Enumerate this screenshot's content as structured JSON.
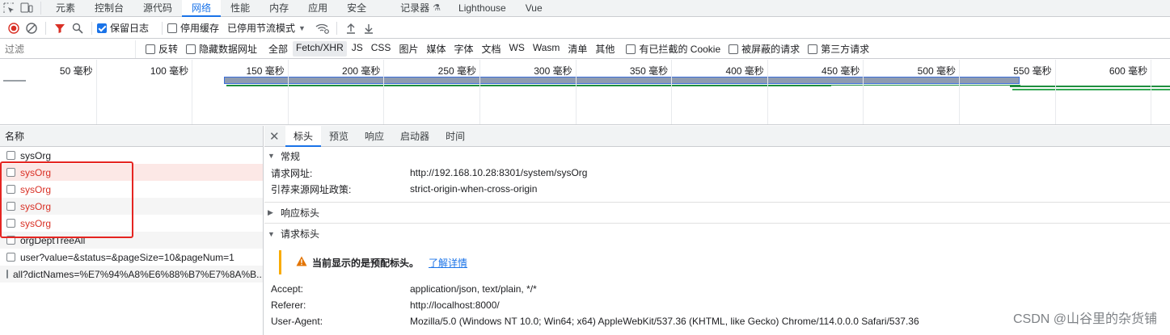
{
  "tabbar": {
    "tabs": [
      "元素",
      "控制台",
      "源代码",
      "网络",
      "性能",
      "内存",
      "应用",
      "安全",
      "记录器",
      "Lighthouse",
      "Vue"
    ],
    "active": "网络"
  },
  "toolbar": {
    "preserve_log": "保留日志",
    "disable_cache": "停用缓存",
    "throttle": "已停用节流模式"
  },
  "filter": {
    "placeholder": "过滤",
    "invert": "反转",
    "hide_data_urls": "隐藏数据网址",
    "types": [
      "全部",
      "Fetch/XHR",
      "JS",
      "CSS",
      "图片",
      "媒体",
      "字体",
      "文档",
      "WS",
      "Wasm",
      "清单",
      "其他"
    ],
    "selected_type": "Fetch/XHR",
    "blocked_cookies": "有已拦截的 Cookie",
    "blocked_requests": "被屏蔽的请求",
    "third_party": "第三方请求"
  },
  "timeline": {
    "ticks": [
      "50 毫秒",
      "100 毫秒",
      "150 毫秒",
      "200 毫秒",
      "250 毫秒",
      "300 毫秒",
      "350 毫秒",
      "400 毫秒",
      "450 毫秒",
      "500 毫秒",
      "550 毫秒",
      "600 毫秒"
    ]
  },
  "requests": {
    "header": "名称",
    "rows": [
      {
        "name": "sysOrg",
        "error": false
      },
      {
        "name": "sysOrg",
        "error": true
      },
      {
        "name": "sysOrg",
        "error": true
      },
      {
        "name": "sysOrg",
        "error": true
      },
      {
        "name": "sysOrg",
        "error": true
      },
      {
        "name": "orgDeptTreeAll",
        "error": false
      },
      {
        "name": "user?value=&status=&pageSize=10&pageNum=1",
        "error": false
      },
      {
        "name": "all?dictNames=%E7%94%A8%E6%88%B7%E7%8A%B...",
        "error": false
      }
    ]
  },
  "detail": {
    "tabs": [
      "标头",
      "预览",
      "响应",
      "启动器",
      "时间"
    ],
    "active_tab": "标头",
    "general": {
      "title": "常规",
      "request_url_label": "请求网址:",
      "request_url": "http://192.168.10.28:8301/system/sysOrg",
      "referrer_policy_label": "引荐来源网址政策:",
      "referrer_policy": "strict-origin-when-cross-origin"
    },
    "response_headers": "响应标头",
    "request_headers": {
      "title": "请求标头",
      "warning": "当前显示的是预配标头。",
      "learn_more": "了解详情",
      "accept_label": "Accept:",
      "accept": "application/json, text/plain, */*",
      "referer_label": "Referer:",
      "referer": "http://localhost:8000/",
      "ua_label": "User-Agent:",
      "ua": "Mozilla/5.0 (Windows NT 10.0; Win64; x64) AppleWebKit/537.36 (KHTML, like Gecko) Chrome/114.0.0.0 Safari/537.36"
    }
  },
  "watermark": "CSDN @山谷里的杂货铺",
  "colors": {
    "accent": "#1a73e8",
    "error": "#d93025",
    "highlight": "#e52521",
    "warning": "#f9ab00"
  }
}
